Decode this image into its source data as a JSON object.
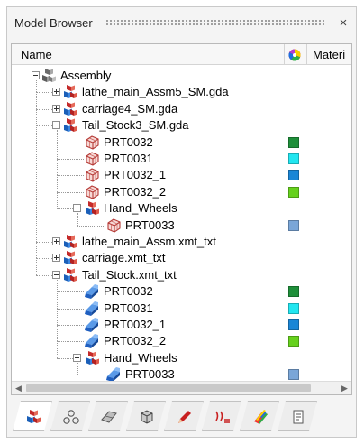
{
  "panel": {
    "title": "Model Browser",
    "close_glyph": "×"
  },
  "columns": {
    "name": "Name",
    "color_icon": "color-wheel-icon",
    "material": "Materi"
  },
  "tree": [
    {
      "label": "Assembly",
      "depth": 0,
      "icon": "assembly-icon",
      "expander": "minus"
    },
    {
      "label": "lathe_main_Assm5_SM.gda",
      "depth": 1,
      "icon": "assembly-red-icon",
      "expander": "plus"
    },
    {
      "label": "carriage4_SM.gda",
      "depth": 1,
      "icon": "assembly-red-icon",
      "expander": "plus"
    },
    {
      "label": "Tail_Stock3_SM.gda",
      "depth": 1,
      "icon": "assembly-red-icon",
      "expander": "minus"
    },
    {
      "label": "PRT0032",
      "depth": 2,
      "icon": "part-mesh-icon",
      "color": "#1e8f3a"
    },
    {
      "label": "PRT0031",
      "depth": 2,
      "icon": "part-mesh-icon",
      "color": "#22e6f0"
    },
    {
      "label": "PRT0032_1",
      "depth": 2,
      "icon": "part-mesh-icon",
      "color": "#1a86d6"
    },
    {
      "label": "PRT0032_2",
      "depth": 2,
      "icon": "part-mesh-icon",
      "color": "#66d11d"
    },
    {
      "label": "Hand_Wheels",
      "depth": 2,
      "icon": "assembly-red-icon",
      "expander": "minus"
    },
    {
      "label": "PRT0033",
      "depth": 3,
      "icon": "part-mesh-icon",
      "color": "#7aa6d8"
    },
    {
      "label": "lathe_main_Assm.xmt_txt",
      "depth": 1,
      "icon": "assembly-red-icon",
      "expander": "plus"
    },
    {
      "label": "carriage.xmt_txt",
      "depth": 1,
      "icon": "assembly-red-icon",
      "expander": "plus"
    },
    {
      "label": "Tail_Stock.xmt_txt",
      "depth": 1,
      "icon": "assembly-red-icon",
      "expander": "minus"
    },
    {
      "label": "PRT0032",
      "depth": 2,
      "icon": "part-solid-icon",
      "color": "#1e8f3a"
    },
    {
      "label": "PRT0031",
      "depth": 2,
      "icon": "part-solid-icon",
      "color": "#22e6f0"
    },
    {
      "label": "PRT0032_1",
      "depth": 2,
      "icon": "part-solid-icon",
      "color": "#1a86d6"
    },
    {
      "label": "PRT0032_2",
      "depth": 2,
      "icon": "part-solid-icon",
      "color": "#66d11d"
    },
    {
      "label": "Hand_Wheels",
      "depth": 2,
      "icon": "assembly-red-icon",
      "expander": "minus"
    },
    {
      "label": "PRT0033",
      "depth": 3,
      "icon": "part-solid-icon",
      "color": "#7aa6d8"
    }
  ],
  "tabs": [
    {
      "icon": "model-tab-icon"
    },
    {
      "icon": "components-tab-icon"
    },
    {
      "icon": "surfaces-tab-icon"
    },
    {
      "icon": "solid-tab-icon"
    },
    {
      "icon": "pencil-tab-icon"
    },
    {
      "icon": "loads-tab-icon"
    },
    {
      "icon": "color-tab-icon"
    },
    {
      "icon": "notes-tab-icon"
    }
  ]
}
